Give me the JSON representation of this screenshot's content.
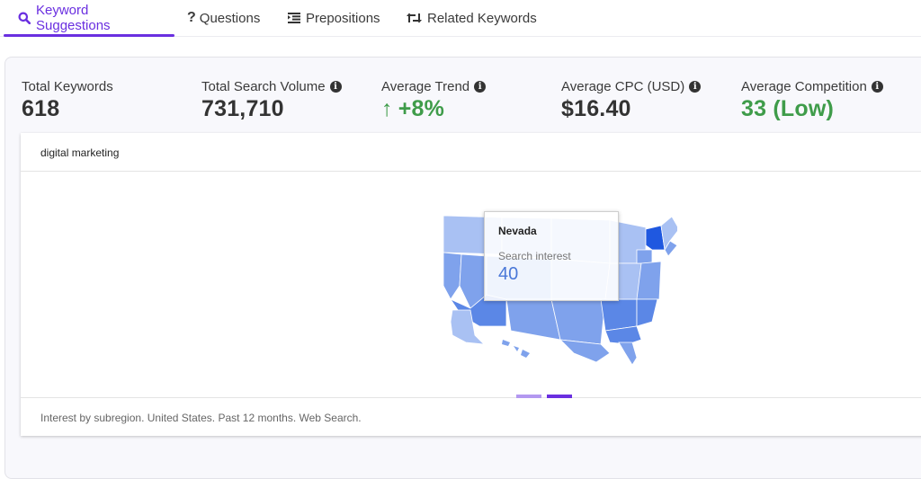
{
  "tabs": [
    {
      "label": "Keyword Suggestions",
      "icon": "search-icon",
      "active": true
    },
    {
      "label": "Questions",
      "icon": "question-icon",
      "active": false
    },
    {
      "label": "Prepositions",
      "icon": "indent-list-icon",
      "active": false
    },
    {
      "label": "Related Keywords",
      "icon": "retweet-icon",
      "active": false
    }
  ],
  "stats": [
    {
      "label": "Total Keywords",
      "value": "618",
      "info": false
    },
    {
      "label": "Total Search Volume",
      "value": "731,710",
      "info": true
    },
    {
      "label": "Average Trend",
      "value": "+8%",
      "arrow": "↑",
      "info": true,
      "color": "#3f9c4a"
    },
    {
      "label": "Average CPC (USD)",
      "value": "$16.40",
      "info": true
    },
    {
      "label": "Average Competition",
      "value": "33 (Low)",
      "info": true,
      "color": "#3f9c4a"
    }
  ],
  "map_card": {
    "keyword": "digital marketing",
    "footer": "Interest by subregion. United States. Past 12 months. Web Search.",
    "tooltip": {
      "region": "Nevada",
      "label": "Search interest",
      "value": "40"
    },
    "highlight_region": "New York",
    "colors": {
      "light": "#a9c1f3",
      "mid": "#7fa2ec",
      "dark": "#5b87e6",
      "max": "#1f58e0"
    }
  },
  "pagination": {
    "count": 2,
    "active_index": 1
  },
  "accent_color": "#6a2fe0"
}
